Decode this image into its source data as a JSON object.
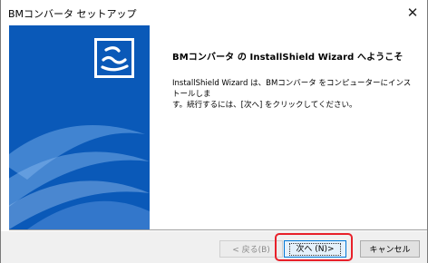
{
  "window": {
    "title": "BMコンバータ セットアップ",
    "close_glyph": "✕"
  },
  "content": {
    "heading": "BMコンバータ の InstallShield Wizard へようこそ",
    "body_line1": "InstallShield Wizard は、BMコンバータ をコンピューターにインストールしま",
    "body_line2": "す。続行するには、[次へ] をクリックしてください。"
  },
  "buttons": {
    "back_label": "< 戻る(B)",
    "next_label": "次へ (N)>",
    "cancel_label": "キャンセル"
  },
  "colors": {
    "panel_blue": "#0a59b8",
    "highlight_red": "#e8202a"
  },
  "icons": {
    "logo": "installshield-logo-icon"
  }
}
